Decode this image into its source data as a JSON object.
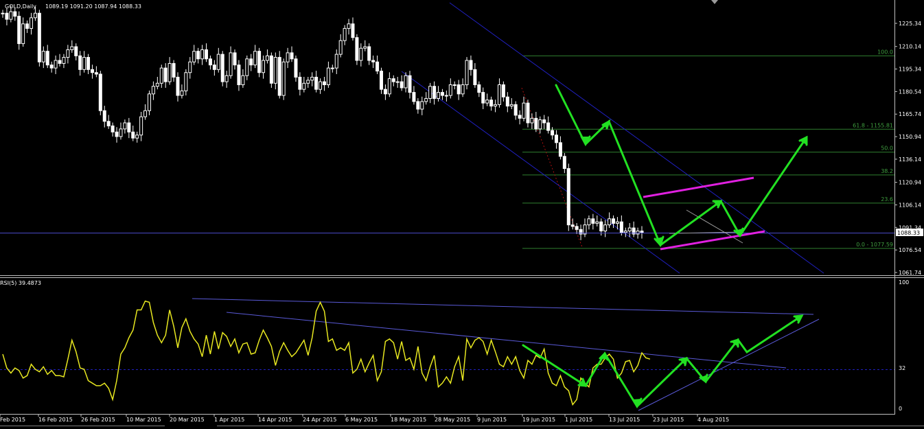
{
  "chart_data": {
    "type": "candlestick",
    "symbol": "GOLD,Daily",
    "ohlc_text": "1089.19 1091.20 1087.94 1088.33",
    "current_price": "1088.33",
    "price_axis": {
      "labels": [
        "1225.34",
        "1210.14",
        "1195.34",
        "1180.54",
        "1165.74",
        "1150.94",
        "1136.14",
        "1120.94",
        "1106.14",
        "1091.34",
        "1076.54",
        "1061.74"
      ],
      "range": [
        1058.5,
        1235.0
      ]
    },
    "x_labels": [
      "Feb 2015",
      "16 Feb 2015",
      "26 Feb 2015",
      "10 Mar 2015",
      "20 Mar 2015",
      "1 Apr 2015",
      "14 Apr 2015",
      "24 Apr 2015",
      "6 May 2015",
      "18 May 2015",
      "28 May 2015",
      "9 Jun 2015",
      "19 Jun 2015",
      "1 Jul 2015",
      "13 Jul 2015",
      "23 Jul 2015",
      "4 Aug 2015"
    ],
    "fibonacci": [
      {
        "label": "100.0",
        "price": 1204.0
      },
      {
        "label": "61.8 - 1155.81",
        "price": 1155.81
      },
      {
        "label": "50.0",
        "price": 1140.8
      },
      {
        "label": "38.2",
        "price": 1125.8
      },
      {
        "label": "23.6",
        "price": 1107.3
      },
      {
        "label": "0.0 - 1077.59",
        "price": 1077.59
      }
    ],
    "closes": [
      1232,
      1228,
      1233,
      1230,
      1212,
      1225,
      1222,
      1229,
      1232,
      1200,
      1207,
      1198,
      1196,
      1201,
      1199,
      1203,
      1208,
      1210,
      1204,
      1195,
      1203,
      1195,
      1193,
      1192,
      1168,
      1161,
      1158,
      1154,
      1151,
      1156,
      1160,
      1154,
      1150,
      1152,
      1164,
      1168,
      1179,
      1184,
      1186,
      1196,
      1187,
      1199,
      1190,
      1178,
      1181,
      1193,
      1200,
      1207,
      1202,
      1208,
      1202,
      1198,
      1195,
      1205,
      1187,
      1191,
      1206,
      1198,
      1185,
      1191,
      1202,
      1198,
      1207,
      1193,
      1201,
      1204,
      1186,
      1203,
      1178,
      1200,
      1206,
      1202,
      1190,
      1182,
      1186,
      1188,
      1190,
      1182,
      1187,
      1185,
      1196,
      1196,
      1205,
      1214,
      1222,
      1225,
      1216,
      1201,
      1209,
      1210,
      1201,
      1200,
      1194,
      1182,
      1179,
      1189,
      1187,
      1187,
      1183,
      1191,
      1180,
      1174,
      1169,
      1174,
      1176,
      1184,
      1176,
      1180,
      1178,
      1178,
      1185,
      1185,
      1179,
      1185,
      1201,
      1195,
      1185,
      1180,
      1173,
      1175,
      1171,
      1172,
      1185,
      1177,
      1171,
      1172,
      1165,
      1163,
      1173,
      1160,
      1163,
      1156,
      1162,
      1160,
      1155,
      1152,
      1147,
      1138,
      1130,
      1093,
      1092,
      1090,
      1087,
      1093,
      1097,
      1094,
      1095,
      1089,
      1093,
      1097,
      1094,
      1095,
      1088,
      1089,
      1091,
      1087,
      1089,
      1088
    ],
    "rsi": {
      "label": "RSI(5) 39.4873",
      "scale_labels": [
        "100",
        "32",
        "0"
      ],
      "level": 32,
      "values": [
        43,
        32,
        28,
        32,
        30,
        24,
        26,
        35,
        31,
        29,
        33,
        27,
        30,
        26,
        26,
        25,
        39,
        54,
        45,
        32,
        31,
        22,
        20,
        18,
        18,
        20,
        16,
        7,
        22,
        43,
        48,
        56,
        62,
        78,
        78,
        85,
        84,
        68,
        58,
        52,
        58,
        78,
        65,
        48,
        64,
        71,
        61,
        55,
        51,
        41,
        58,
        43,
        61,
        47,
        60,
        57,
        49,
        55,
        44,
        51,
        52,
        43,
        44,
        54,
        62,
        56,
        49,
        34,
        45,
        52,
        46,
        41,
        44,
        49,
        54,
        42,
        56,
        77,
        84,
        77,
        53,
        55,
        46,
        48,
        46,
        52,
        28,
        31,
        39,
        29,
        36,
        42,
        22,
        29,
        53,
        55,
        52,
        39,
        53,
        38,
        40,
        31,
        49,
        28,
        22,
        33,
        42,
        17,
        20,
        25,
        20,
        33,
        41,
        22,
        55,
        48,
        54,
        56,
        53,
        43,
        54,
        45,
        35,
        33,
        41,
        35,
        41,
        30,
        24,
        38,
        35,
        42,
        40,
        47,
        28,
        20,
        18,
        26,
        17,
        14,
        3,
        7,
        24,
        20,
        17,
        32,
        35,
        35,
        40,
        43,
        39,
        24,
        28,
        37,
        38,
        29,
        34,
        44,
        40,
        39
      ],
      "range": [
        0,
        100
      ]
    }
  }
}
